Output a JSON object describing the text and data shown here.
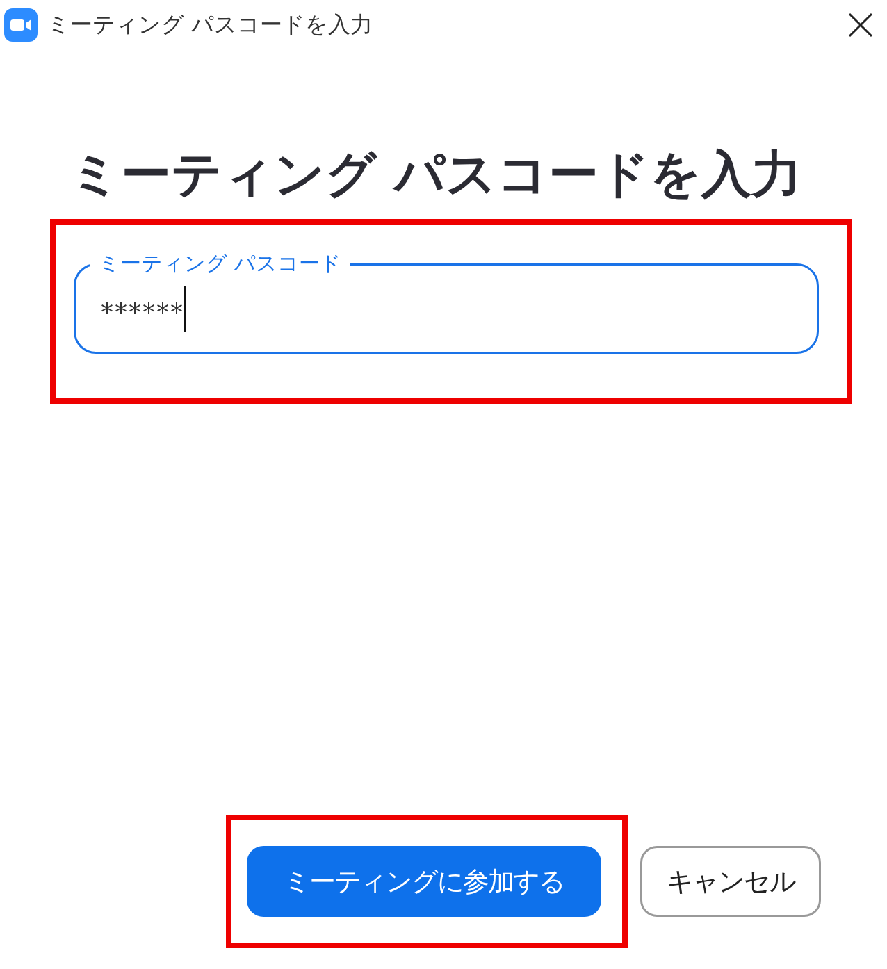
{
  "window": {
    "title": "ミーティング パスコードを入力"
  },
  "heading": "ミーティング パスコードを入力",
  "passcode_field": {
    "label": "ミーティング パスコード",
    "value": "******",
    "focused": true
  },
  "buttons": [
    {
      "label": "ミーティングに参加する",
      "kind": "primary"
    },
    {
      "label": "キャンセル",
      "kind": "secondary"
    }
  ]
}
